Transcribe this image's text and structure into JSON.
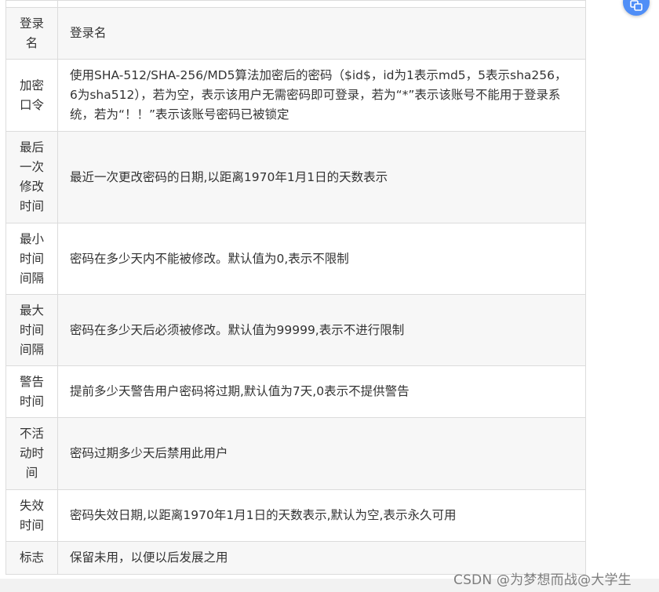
{
  "rows": [
    {
      "name": "登录名",
      "desc": "登录名"
    },
    {
      "name": "加密口令",
      "desc": "使用SHA-512/SHA-256/MD5算法加密后的密码（$id$，id为1表示md5，5表示sha256，6为sha512），若为空，表示该用户无需密码即可登录，若为“*”表示该账号不能用于登录系统，若为“！！”表示该账号密码已被锁定"
    },
    {
      "name": "最后一次修改时间",
      "desc": "最近一次更改密码的日期,以距离1970年1月1日的天数表示"
    },
    {
      "name": "最小时间间隔",
      "desc": "密码在多少天内不能被修改。默认值为0,表示不限制"
    },
    {
      "name": "最大时间间隔",
      "desc": "密码在多少天后必须被修改。默认值为99999,表示不进行限制"
    },
    {
      "name": "警告时间",
      "desc": "提前多少天警告用户密码将过期,默认值为7天,0表示不提供警告"
    },
    {
      "name": "不活动时间",
      "desc": "密码过期多少天后禁用此用户"
    },
    {
      "name": "失效时间",
      "desc": "密码失效日期,以距离1970年1月1日的天数表示,默认为空,表示永久可用"
    },
    {
      "name": "标志",
      "desc": "保留未用，以便以后发展之用"
    }
  ],
  "watermark": "CSDN @为梦想而战@大学生",
  "icons": {
    "float_button": "translate-icon"
  },
  "colors": {
    "border": "#dcdcdc",
    "row_alt": "#f7f7f7",
    "float_button": "#4f8ef7",
    "watermark": "#7d7d7d"
  }
}
